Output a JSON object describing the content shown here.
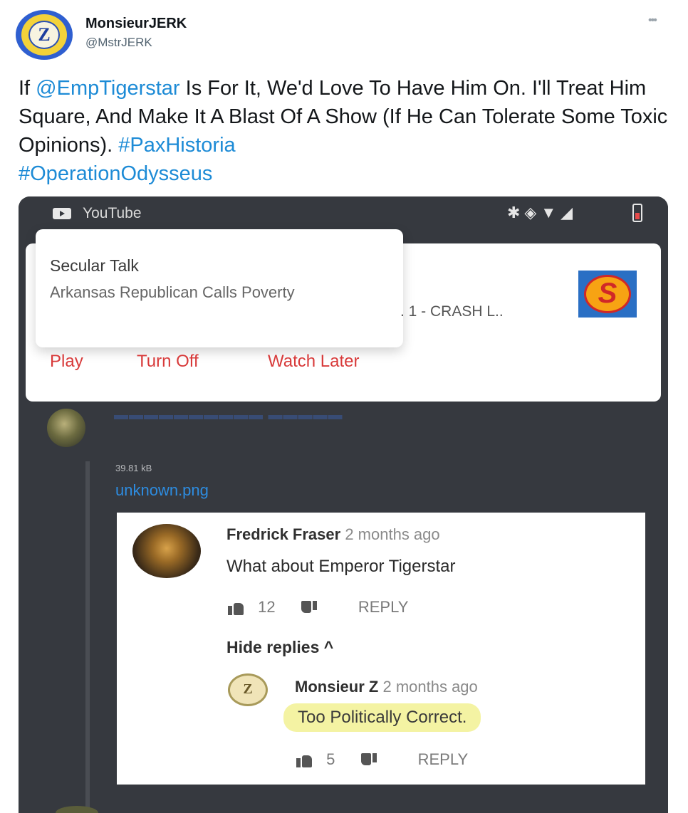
{
  "tweet": {
    "display_name": "MonsieurJERK",
    "handle": "@MstrJERK",
    "more_icon": "more-icon",
    "avatar_letter": "Z",
    "text_parts": {
      "pre": "If ",
      "mention": "@EmpTigerstar",
      "body": " Is For It, We'd Love To Have Him On. I'll Treat Him Square, And Make It A Blast Of A Show (If He Can Tolerate Some Toxic Opinions). ",
      "hashtag1": "#PaxHistoria",
      "hashtag2": "#OperationOdysseus"
    },
    "link_color": "#1d8bd6"
  },
  "screenshot": {
    "statusbar": {
      "app_label": "YouTube"
    },
    "notification": {
      "channel": "Secular Talk",
      "title": "Arkansas Republican Calls Poverty",
      "subtitle": ". 1 - CRASH L..",
      "actions": [
        "Play",
        "Turn Off",
        "Watch Later"
      ],
      "action_color": "#d83a3a",
      "logo_letter": "S"
    },
    "discord": {
      "file_size": "39.81 kB",
      "file_name": "unknown.png"
    },
    "comment": {
      "author": "Fredrick Fraser",
      "time": "2 months ago",
      "text": "What about Emperor Tigerstar",
      "likes": "12",
      "reply_label": "REPLY",
      "hide_replies": "Hide replies ^",
      "reply": {
        "author": "Monsieur Z",
        "time": "2 months ago",
        "text": "Too Politically Correct.",
        "likes": "5",
        "reply_label": "REPLY",
        "avatar_letter": "Z"
      }
    }
  }
}
